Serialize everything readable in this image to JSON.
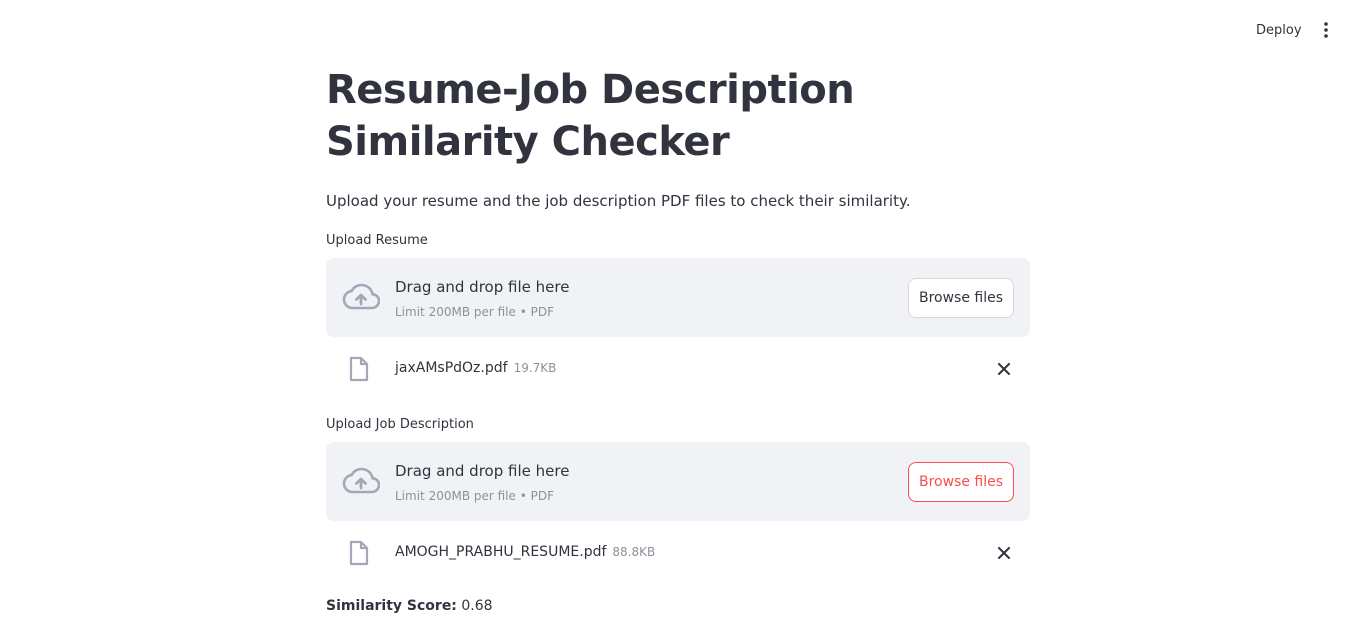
{
  "header": {
    "deploy_label": "Deploy",
    "menu_icon": "more-vertical-icon"
  },
  "page": {
    "title": "Resume-Job Description Similarity Checker",
    "intro": "Upload your resume and the job description PDF files to check their similarity."
  },
  "uploaders": [
    {
      "label": "Upload Resume",
      "drop_title": "Drag and drop file here",
      "drop_hint": "Limit 200MB per file • PDF",
      "browse_label": "Browse files",
      "file": {
        "name": "jaxAMsPdOz.pdf",
        "size": "19.7KB"
      }
    },
    {
      "label": "Upload Job Description",
      "drop_title": "Drag and drop file here",
      "drop_hint": "Limit 200MB per file • PDF",
      "browse_label": "Browse files",
      "file": {
        "name": "AMOGH_PRABHU_RESUME.pdf",
        "size": "88.8KB"
      }
    }
  ],
  "result": {
    "label": "Similarity Score:",
    "value": "0.68"
  },
  "colors": {
    "text": "#31333f",
    "muted": "#8e919b",
    "dropzone_bg": "#f0f2f6",
    "accent": "#ff4b4b",
    "icon": "#a3a8b8"
  }
}
